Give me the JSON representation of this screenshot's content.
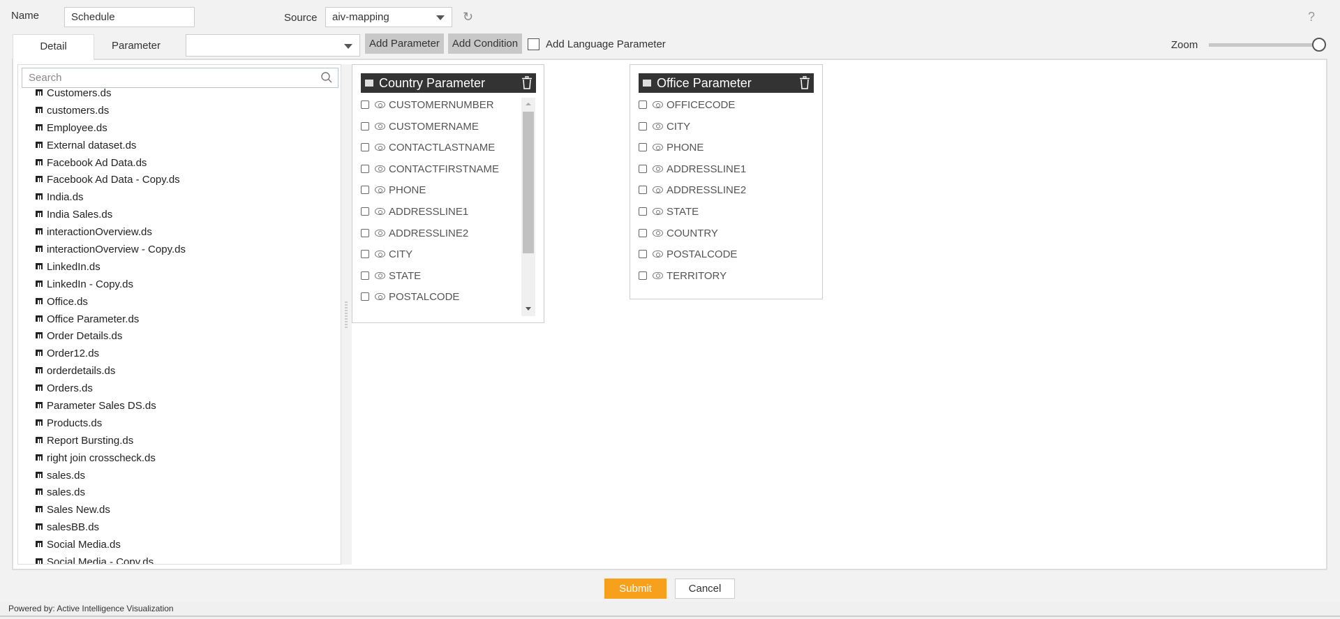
{
  "header": {
    "name_label": "Name",
    "name_value": "Schedule",
    "source_label": "Source",
    "source_value": "aiv-mapping",
    "help": "?"
  },
  "tabs": [
    {
      "label": "Detail",
      "active": true
    },
    {
      "label": "Parameter",
      "active": false
    }
  ],
  "toolbar": {
    "parameter_select_value": "",
    "add_parameter": "Add Parameter",
    "add_condition": "Add Condition",
    "language_label": "Add Language Parameter",
    "language_checked": false,
    "zoom_label": "Zoom",
    "zoom_level": 1.0
  },
  "sidebar": {
    "search_placeholder": "Search",
    "items": [
      "Customers.ds",
      "customers.ds",
      "Employee.ds",
      "External dataset.ds",
      "Facebook Ad Data.ds",
      "Facebook Ad Data - Copy.ds",
      "India.ds",
      "India Sales.ds",
      "interactionOverview.ds",
      "interactionOverview - Copy.ds",
      "LinkedIn.ds",
      "LinkedIn - Copy.ds",
      "Office.ds",
      "Office Parameter.ds",
      "Order Details.ds",
      "Order12.ds",
      "orderdetails.ds",
      "Orders.ds",
      "Parameter Sales DS.ds",
      "Products.ds",
      "Report Bursting.ds",
      "right join crosscheck.ds",
      "sales.ds",
      "sales.ds",
      "Sales New.ds",
      "salesBB.ds",
      "Social Media.ds",
      "Social Media - Copy.ds"
    ]
  },
  "cards": [
    {
      "title": "Country Parameter",
      "fields": [
        "CUSTOMERNUMBER",
        "CUSTOMERNAME",
        "CONTACTLASTNAME",
        "CONTACTFIRSTNAME",
        "PHONE",
        "ADDRESSLINE1",
        "ADDRESSLINE2",
        "CITY",
        "STATE",
        "POSTALCODE"
      ]
    },
    {
      "title": "Office Parameter",
      "fields": [
        "OFFICECODE",
        "CITY",
        "PHONE",
        "ADDRESSLINE1",
        "ADDRESSLINE2",
        "STATE",
        "COUNTRY",
        "POSTALCODE",
        "TERRITORY"
      ]
    }
  ],
  "footer": {
    "submit": "Submit",
    "cancel": "Cancel",
    "powered_by": "Powered by: Active Intelligence Visualization"
  },
  "colors": {
    "submit": "#f7a01c",
    "card_header": "#333333"
  }
}
